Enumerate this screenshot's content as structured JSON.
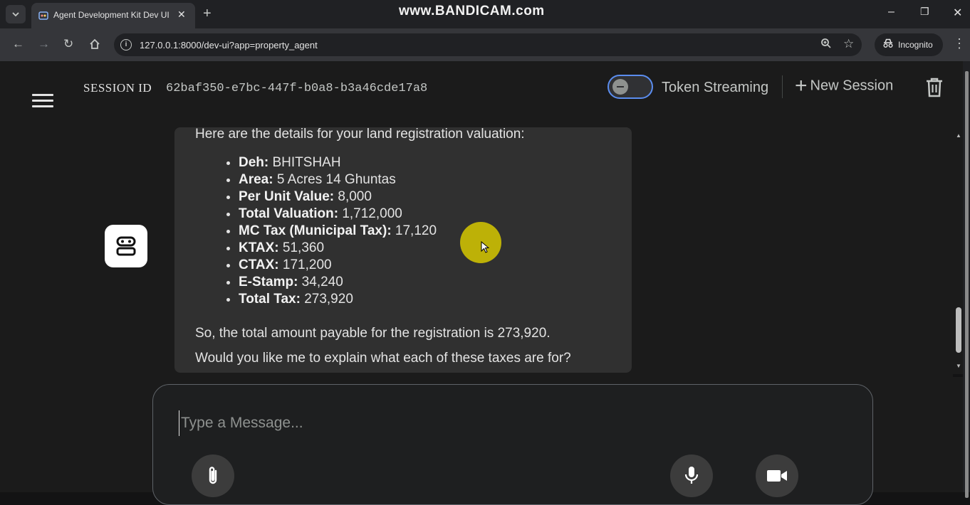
{
  "browser": {
    "tab_title": "Agent Development Kit Dev UI",
    "tab_close": "✕",
    "new_tab": "+",
    "url": "127.0.0.1:8000/dev-ui?app=property_agent",
    "incognito_label": "Incognito",
    "window_controls": {
      "minimize": "–",
      "restore": "❐",
      "close": "✕"
    }
  },
  "watermark": "www.BANDICAM.com",
  "header": {
    "session_label": "SESSION ID",
    "session_id": "62baf350-e7bc-447f-b0a8-b3a46cde17a8",
    "token_streaming_label": "Token Streaming",
    "token_streaming_enabled": false,
    "new_session_label": "New Session"
  },
  "message": {
    "intro": "Here are the details for your land registration valuation:",
    "items": [
      {
        "key": "Deh:",
        "value": " BHITSHAH"
      },
      {
        "key": "Area:",
        "value": " 5 Acres 14 Ghuntas"
      },
      {
        "key": "Per Unit Value:",
        "value": " 8,000"
      },
      {
        "key": "Total Valuation:",
        "value": " 1,712,000"
      },
      {
        "key": "MC Tax (Municipal Tax):",
        "value": " 17,120"
      },
      {
        "key": "KTAX:",
        "value": " 51,360"
      },
      {
        "key": "CTAX:",
        "value": " 171,200"
      },
      {
        "key": "E-Stamp:",
        "value": " 34,240"
      },
      {
        "key": "Total Tax:",
        "value": " 273,920"
      }
    ],
    "total_line": "So, the total amount payable for the registration is 273,920.",
    "question": "Would you like me to explain what each of these taxes are for?"
  },
  "composer": {
    "placeholder": "Type a Message...",
    "value": ""
  },
  "icons": {
    "attach": "paperclip-icon",
    "mic": "microphone-icon",
    "video": "video-camera-icon",
    "bot": "robot-icon",
    "delete": "trash-icon"
  },
  "colors": {
    "toggle_border": "#5b8def",
    "cursor_highlight": "#d6c800",
    "bubble_bg": "#303030",
    "app_bg": "#1b1b1b"
  }
}
